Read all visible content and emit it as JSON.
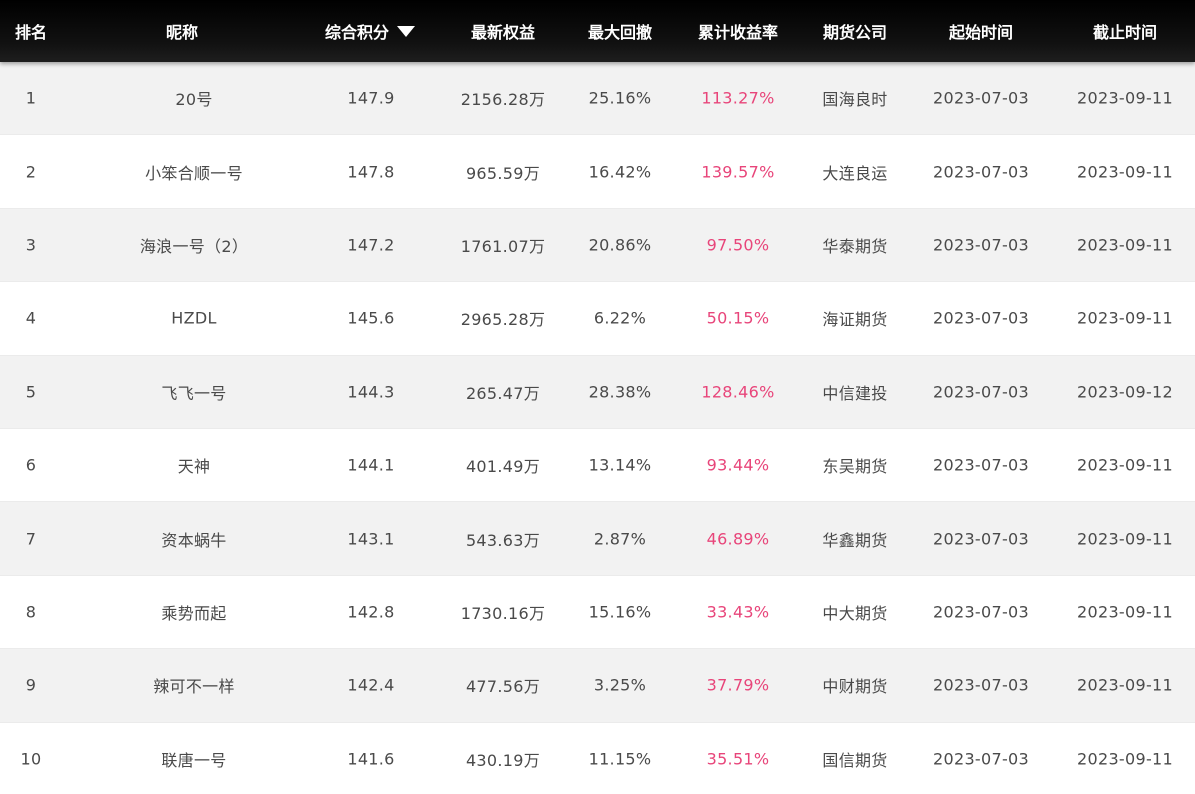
{
  "header": {
    "rank": "排名",
    "nickname": "昵称",
    "score": "综合积分",
    "equity": "最新权益",
    "max_drawdown": "最大回撤",
    "cum_return": "累计收益率",
    "futures_company": "期货公司",
    "start_date": "起始时间",
    "end_date": "截止时间",
    "sort_icon": "caret-down-icon"
  },
  "colors": {
    "header_bg": "#000000",
    "header_text": "#ffffff",
    "row_alt_bg": "#f2f2f2",
    "text": "#4a4a4a",
    "return_text": "#e8457a"
  },
  "rows": [
    {
      "rank": "1",
      "nickname": "20号",
      "score": "147.9",
      "equity": "2156.28万",
      "max_drawdown": "25.16%",
      "cum_return": "113.27%",
      "company": "国海良时",
      "start": "2023-07-03",
      "end": "2023-09-11"
    },
    {
      "rank": "2",
      "nickname": "小笨合顺一号",
      "score": "147.8",
      "equity": "965.59万",
      "max_drawdown": "16.42%",
      "cum_return": "139.57%",
      "company": "大连良运",
      "start": "2023-07-03",
      "end": "2023-09-11"
    },
    {
      "rank": "3",
      "nickname": "海浪一号（2）",
      "score": "147.2",
      "equity": "1761.07万",
      "max_drawdown": "20.86%",
      "cum_return": "97.50%",
      "company": "华泰期货",
      "start": "2023-07-03",
      "end": "2023-09-11"
    },
    {
      "rank": "4",
      "nickname": "HZDL",
      "score": "145.6",
      "equity": "2965.28万",
      "max_drawdown": "6.22%",
      "cum_return": "50.15%",
      "company": "海证期货",
      "start": "2023-07-03",
      "end": "2023-09-11"
    },
    {
      "rank": "5",
      "nickname": "飞飞一号",
      "score": "144.3",
      "equity": "265.47万",
      "max_drawdown": "28.38%",
      "cum_return": "128.46%",
      "company": "中信建投",
      "start": "2023-07-03",
      "end": "2023-09-12"
    },
    {
      "rank": "6",
      "nickname": "天神",
      "score": "144.1",
      "equity": "401.49万",
      "max_drawdown": "13.14%",
      "cum_return": "93.44%",
      "company": "东吴期货",
      "start": "2023-07-03",
      "end": "2023-09-11"
    },
    {
      "rank": "7",
      "nickname": "资本蜗牛",
      "score": "143.1",
      "equity": "543.63万",
      "max_drawdown": "2.87%",
      "cum_return": "46.89%",
      "company": "华鑫期货",
      "start": "2023-07-03",
      "end": "2023-09-11"
    },
    {
      "rank": "8",
      "nickname": "乘势而起",
      "score": "142.8",
      "equity": "1730.16万",
      "max_drawdown": "15.16%",
      "cum_return": "33.43%",
      "company": "中大期货",
      "start": "2023-07-03",
      "end": "2023-09-11"
    },
    {
      "rank": "9",
      "nickname": "辣可不一样",
      "score": "142.4",
      "equity": "477.56万",
      "max_drawdown": "3.25%",
      "cum_return": "37.79%",
      "company": "中财期货",
      "start": "2023-07-03",
      "end": "2023-09-11"
    },
    {
      "rank": "10",
      "nickname": "联唐一号",
      "score": "141.6",
      "equity": "430.19万",
      "max_drawdown": "11.15%",
      "cum_return": "35.51%",
      "company": "国信期货",
      "start": "2023-07-03",
      "end": "2023-09-11"
    }
  ]
}
